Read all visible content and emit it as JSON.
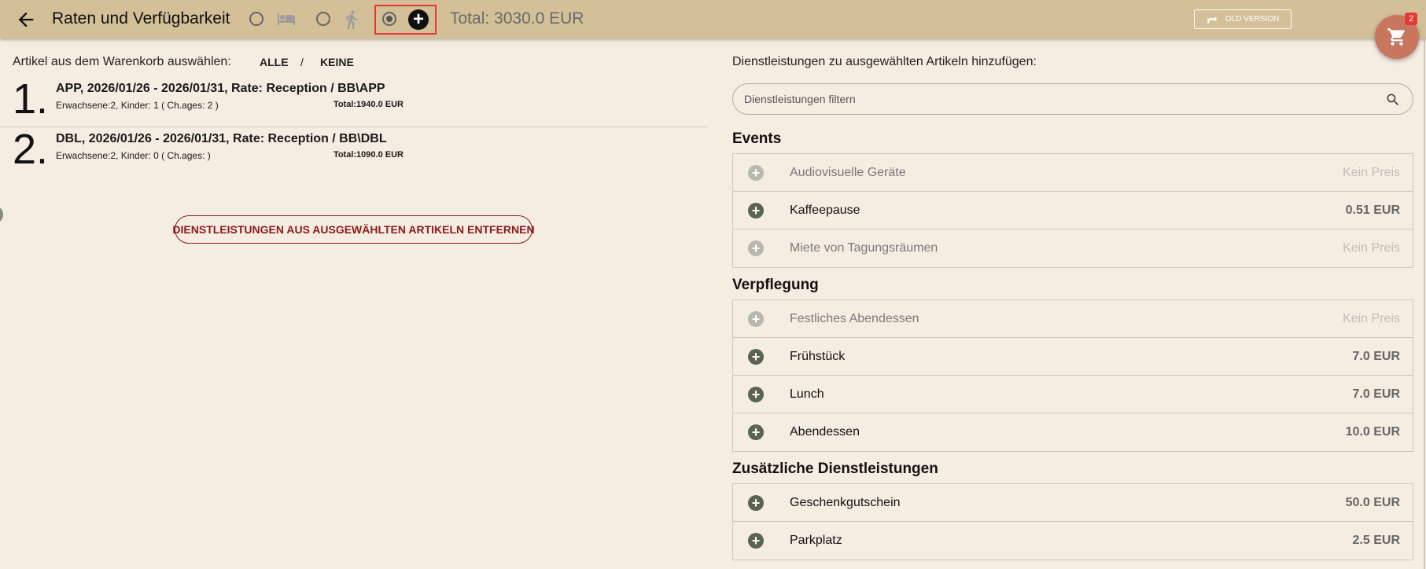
{
  "header": {
    "title": "Raten und Verfügbarkeit",
    "total": "Total: 3030.0 EUR",
    "old_version_label": "OLD VERSION",
    "steps": [
      {
        "name": "rooms",
        "icon": "bed-icon",
        "selected": false
      },
      {
        "name": "activities",
        "icon": "walk-icon",
        "selected": false
      },
      {
        "name": "services",
        "icon": "add-circle-icon",
        "selected": true
      }
    ]
  },
  "cart": {
    "badge": "2",
    "icon": "shopping-cart-icon"
  },
  "left": {
    "select_label": "Artikel aus dem Warenkorb auswählen:",
    "select_all": "ALLE",
    "separator": "/",
    "select_none": "KEINE",
    "items": [
      {
        "number": "1.",
        "title": "APP, 2026/01/26 - 2026/01/31, Rate: Reception / BB\\APP",
        "guests": "Erwachsene:2, Kinder: 1 ( Ch.ages: 2 )",
        "total": "Total:1940.0 EUR"
      },
      {
        "number": "2.",
        "title": "DBL, 2026/01/26 - 2026/01/31, Rate: Reception / BB\\DBL",
        "guests": "Erwachsene:2, Kinder: 0 ( Ch.ages: )",
        "total": "Total:1090.0 EUR"
      }
    ],
    "remove_button": "DIENSTLEISTUNGEN AUS AUSGEWÄHLTEN ARTIKELN ENTFERNEN"
  },
  "right": {
    "add_label": "Dienstleistungen zu ausgewählten Artikeln hinzufügen:",
    "filter_placeholder": "Dienstleistungen filtern",
    "groups": [
      {
        "title": "Events",
        "services": [
          {
            "name": "Audiovisuelle Geräte",
            "price": "Kein Preis",
            "enabled": false
          },
          {
            "name": "Kaffeepause",
            "price": "0.51 EUR",
            "enabled": true
          },
          {
            "name": "Miete von Tagungsräumen",
            "price": "Kein Preis",
            "enabled": false
          }
        ]
      },
      {
        "title": "Verpflegung",
        "services": [
          {
            "name": "Festliches Abendessen",
            "price": "Kein Preis",
            "enabled": false
          },
          {
            "name": "Frühstück",
            "price": "7.0 EUR",
            "enabled": true
          },
          {
            "name": "Lunch",
            "price": "7.0 EUR",
            "enabled": true
          },
          {
            "name": "Abendessen",
            "price": "10.0 EUR",
            "enabled": true
          }
        ]
      },
      {
        "title": "Zusätzliche Dienstleistungen",
        "services": [
          {
            "name": "Geschenkgutschein",
            "price": "50.0 EUR",
            "enabled": true
          },
          {
            "name": "Parkplatz",
            "price": "2.5 EUR",
            "enabled": true
          }
        ]
      }
    ]
  },
  "colors": {
    "toolbar": "#d3bf98",
    "background": "#f5ece2",
    "cart_fab": "#c8775e",
    "accent_red": "#8b1a1a",
    "add_icon": "#5a6450"
  }
}
